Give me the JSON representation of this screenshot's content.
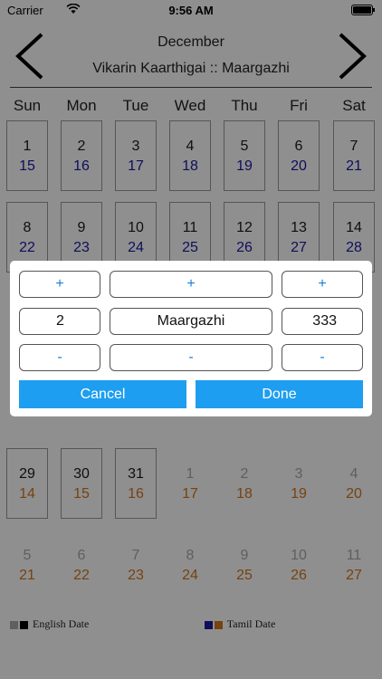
{
  "status_bar": {
    "carrier": "Carrier",
    "time": "9:56 AM"
  },
  "header": {
    "month": "December",
    "tamil_period": "Vikarin Kaarthigai ::  Maargazhi",
    "prev_icon": "chevron-left-icon",
    "next_icon": "chevron-right-icon"
  },
  "weekdays": [
    "Sun",
    "Mon",
    "Tue",
    "Wed",
    "Thu",
    "Fri",
    "Sat"
  ],
  "weeks": [
    [
      {
        "d": "1",
        "t": "15"
      },
      {
        "d": "2",
        "t": "16"
      },
      {
        "d": "3",
        "t": "17"
      },
      {
        "d": "4",
        "t": "18"
      },
      {
        "d": "5",
        "t": "19"
      },
      {
        "d": "6",
        "t": "20"
      },
      {
        "d": "7",
        "t": "21"
      }
    ],
    [
      {
        "d": "8",
        "t": "22"
      },
      {
        "d": "9",
        "t": "23"
      },
      {
        "d": "10",
        "t": "24"
      },
      {
        "d": "11",
        "t": "25"
      },
      {
        "d": "12",
        "t": "26"
      },
      {
        "d": "13",
        "t": "27"
      },
      {
        "d": "14",
        "t": "28"
      }
    ],
    [
      {
        "d": "29",
        "t": "14"
      },
      {
        "d": "30",
        "t": "15"
      },
      {
        "d": "31",
        "t": "16"
      },
      {
        "d": "1",
        "t": "17"
      },
      {
        "d": "2",
        "t": "18"
      },
      {
        "d": "3",
        "t": "19"
      },
      {
        "d": "4",
        "t": "20"
      }
    ],
    [
      {
        "d": "5",
        "t": "21"
      },
      {
        "d": "6",
        "t": "22"
      },
      {
        "d": "7",
        "t": "23"
      },
      {
        "d": "8",
        "t": "24"
      },
      {
        "d": "9",
        "t": "25"
      },
      {
        "d": "10",
        "t": "26"
      },
      {
        "d": "11",
        "t": "27"
      }
    ]
  ],
  "legend": {
    "english": "English Date",
    "tamil": "Tamil Date"
  },
  "picker": {
    "plus": "+",
    "minus": "-",
    "day_value": "2",
    "month_value": "Maargazhi",
    "year_value": "333",
    "cancel_label": "Cancel",
    "done_label": "Done"
  },
  "colors": {
    "tamil_date": "#1a1aa0",
    "other_month_tamil": "#d2761e",
    "accent": "#1e9ef0",
    "link": "#1a7fd6"
  }
}
